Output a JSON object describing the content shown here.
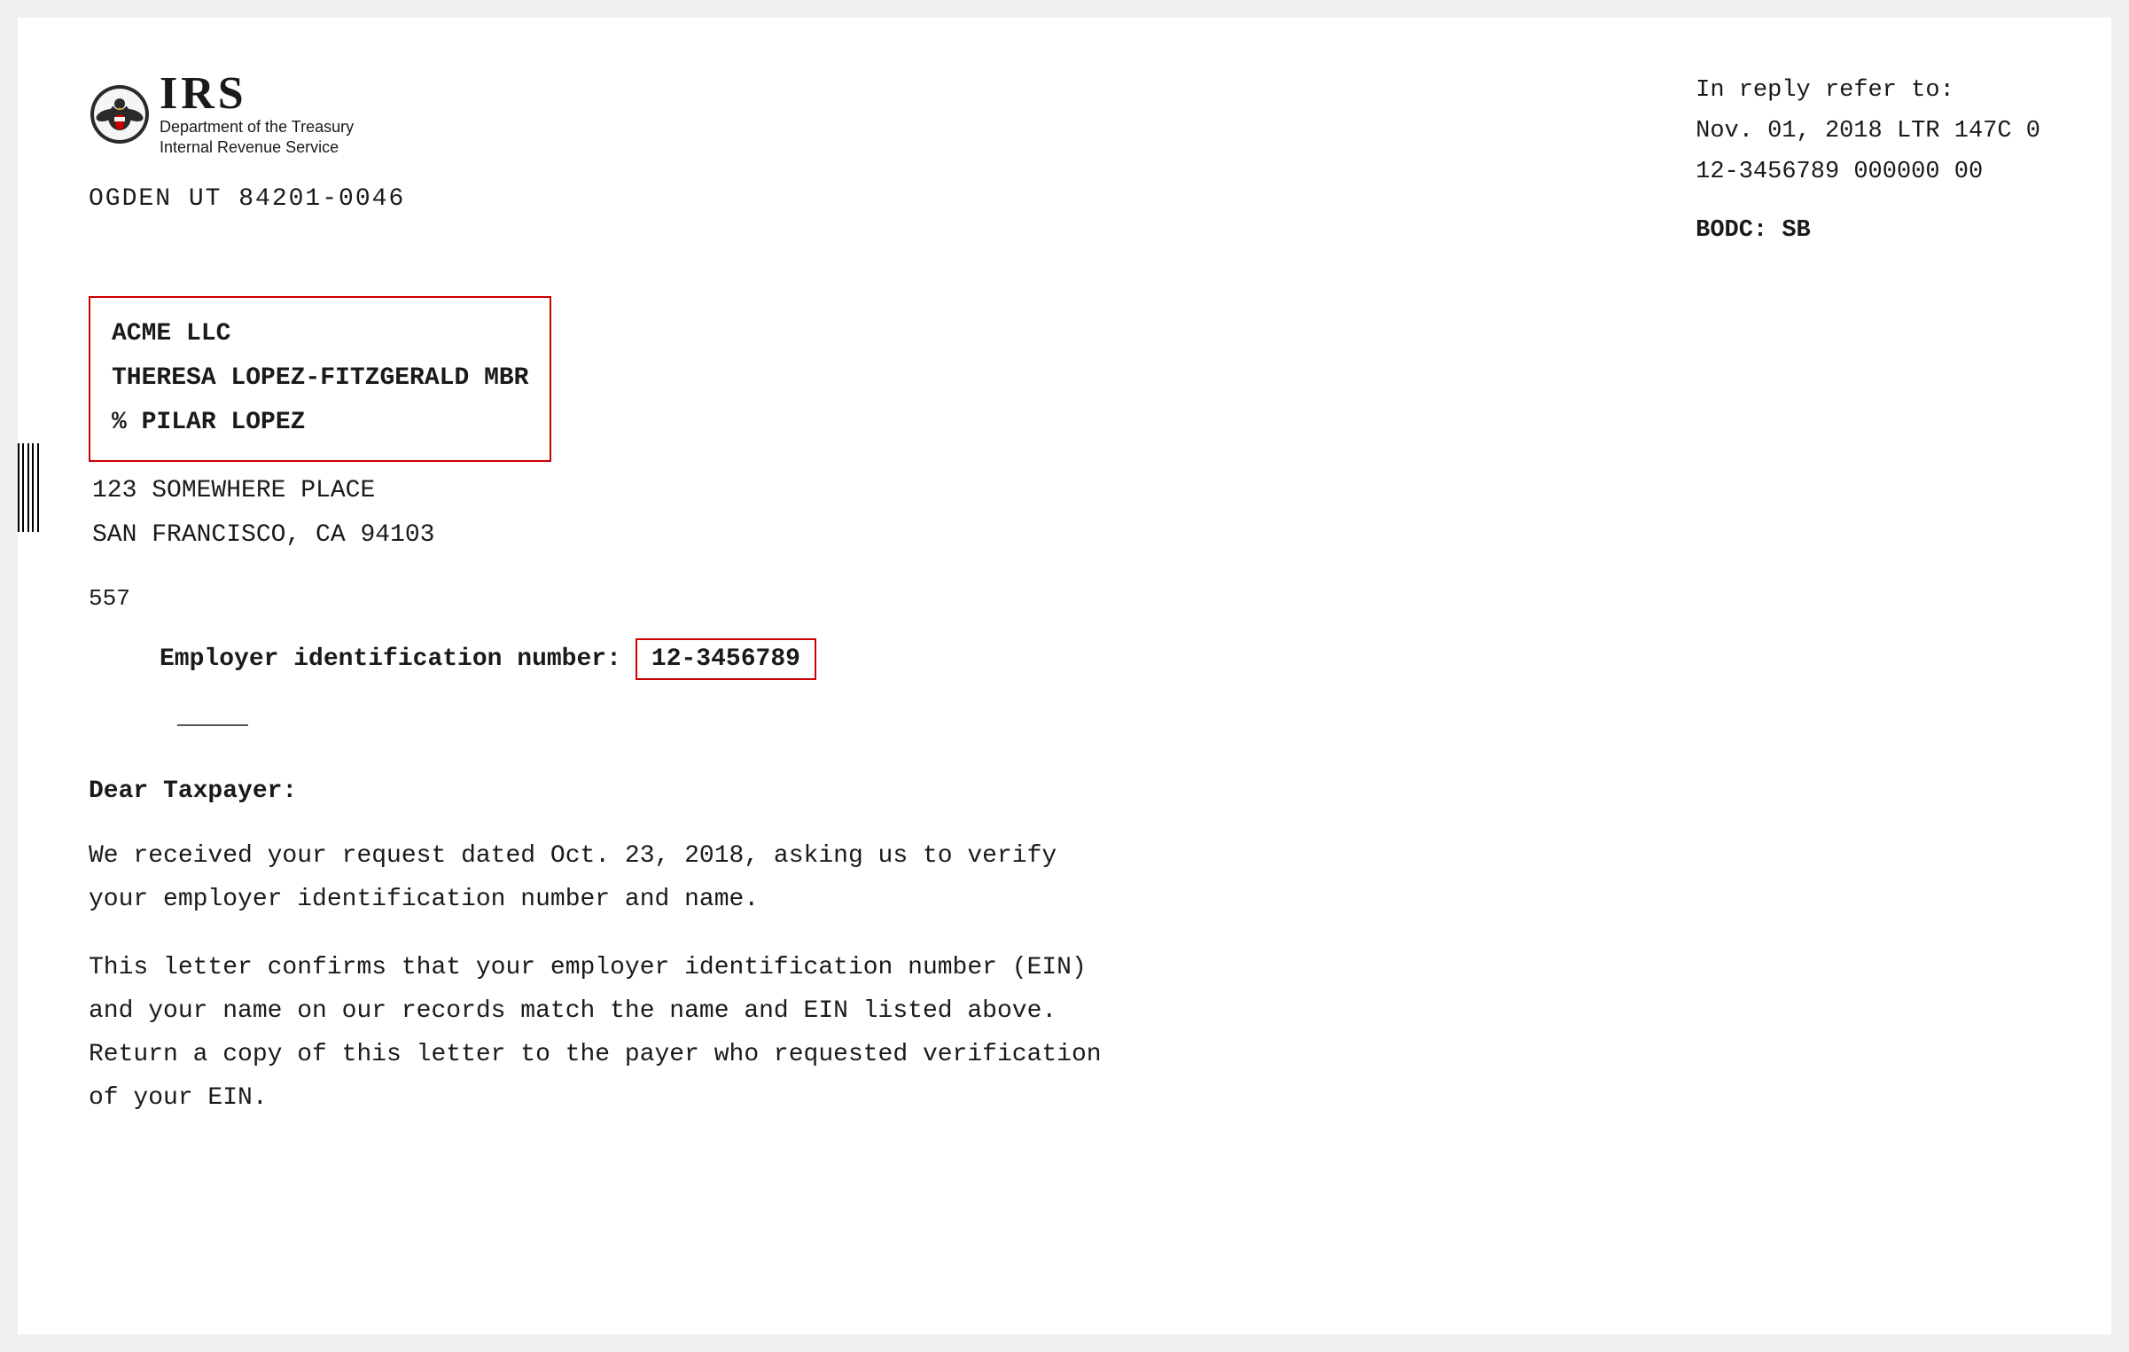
{
  "document": {
    "header": {
      "logo": {
        "irs_letters": "IRS",
        "subtitle_line1": "Department of the Treasury",
        "subtitle_line2": "Internal Revenue Service"
      },
      "sender_address": "OGDEN  UT  84201-0046",
      "reply_block": {
        "line1": "In reply refer to:",
        "line2": "Nov. 01, 2018    LTR 147C    0",
        "line3": "12-3456789    000000 00",
        "bodc": "BODC: SB"
      }
    },
    "recipient": {
      "boxed": {
        "line1": "ACME LLC",
        "line2": "THERESA LOPEZ-FITZGERALD MBR",
        "line3": "% PILAR LOPEZ"
      },
      "plain": {
        "line1": "123 SOMEWHERE PLACE",
        "line2": "SAN FRANCISCO, CA    94103"
      }
    },
    "page_number": "557",
    "ein_section": {
      "label": "Employer identification number:",
      "value": "12-3456789"
    },
    "body": {
      "dear": "Dear Taxpayer:",
      "paragraph1": "We received your request dated Oct. 23, 2018, asking us to verify\nyour employer identification number and name.",
      "paragraph2": "This letter confirms that your employer identification number (EIN)\nand your name on our records match the name and EIN listed above.\nReturn a copy of this letter to the payer who requested verification\nof your EIN."
    }
  }
}
